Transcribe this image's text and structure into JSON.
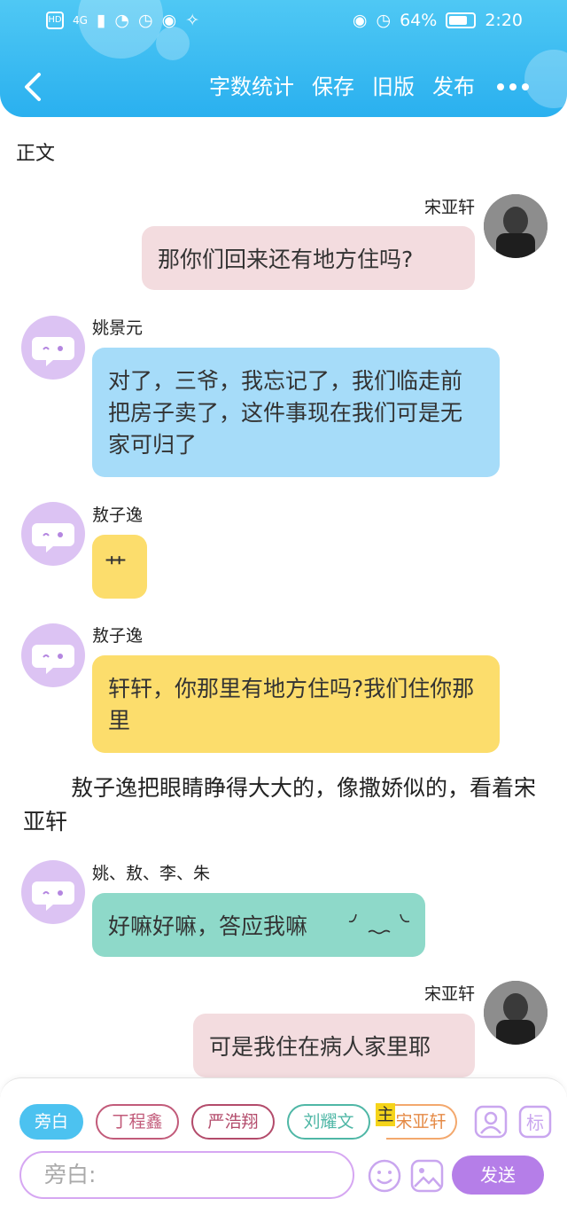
{
  "status_bar": {
    "left_badges": [
      "HD",
      "4G"
    ],
    "battery": "64%",
    "time": "2:20"
  },
  "nav": {
    "actions": [
      "字数统计",
      "保存",
      "旧版",
      "发布"
    ]
  },
  "section_title": "正文",
  "messages": [
    {
      "speaker": "宋亚轩",
      "text": "那你们回来还有地方住吗?",
      "color": "#f3dcdf"
    },
    {
      "speaker": "姚景元",
      "text": "对了，三爷，我忘记了，我们临走前把房子卖了，这件事现在我们可是无家可归了",
      "color": "#a6dcf9"
    },
    {
      "speaker": "敖子逸",
      "text": "艹",
      "color": "#fcdd6c"
    },
    {
      "speaker": "敖子逸",
      "text": "轩轩，你那里有地方住吗?我们住你那里",
      "color": "#fcdd6c"
    },
    {
      "speaker": "姚、敖、李、朱",
      "text": "好嘛好嘛，答应我嘛",
      "color": "#8ed9c9"
    },
    {
      "speaker": "宋亚轩",
      "text": "可是我住在病人家里耶",
      "color": "#f3dcdf"
    }
  ],
  "narration": "敖子逸把眼睛睁得大大的，像撒娇似的，看着宋亚轩",
  "bottom": {
    "chips": [
      "旁白",
      "丁程鑫",
      "严浩翔",
      "刘耀文",
      "宋亚轩"
    ],
    "main_tag": "主",
    "input_placeholder": "旁白:",
    "send_label": "发送"
  },
  "colors": {
    "header": "#2ab0ef",
    "send": "#b57ee8"
  }
}
